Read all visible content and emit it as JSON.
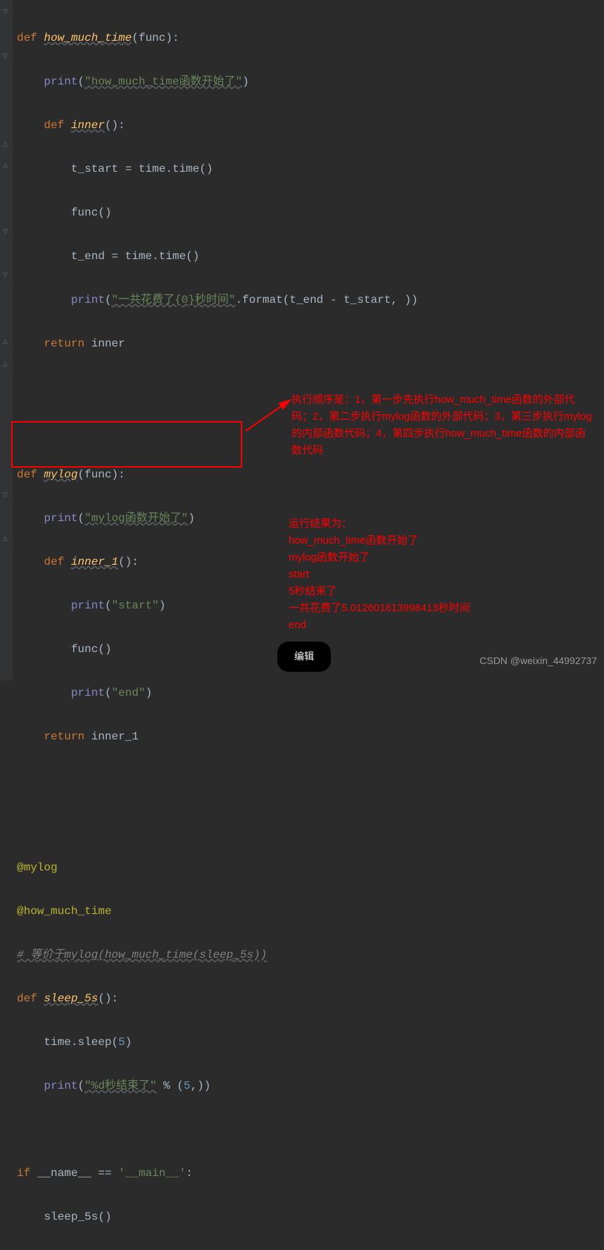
{
  "code": {
    "l1": {
      "def": "def ",
      "fn": "how_much_time",
      "args": "(func):"
    },
    "l2": {
      "pr": "print",
      "paren": "(",
      "str": "\"how_much_time函数开始了\"",
      "close": ")"
    },
    "l3": {
      "def": "def ",
      "fn": "inner",
      "args": "():"
    },
    "l4": "        t_start = time.time()",
    "l5": "        func()",
    "l6": "        t_end = time.time()",
    "l7": {
      "pr": "print",
      "paren": "(",
      "str": "\"一共花费了{0}秒时间\"",
      "fmt": ".format(t_end - t_start",
      "comma": ", ",
      "close": "))"
    },
    "l8": {
      "ret": "return ",
      "v": "inner"
    },
    "l10": {
      "def": "def ",
      "fn": "mylog",
      "args": "(func):"
    },
    "l11": {
      "pr": "print",
      "paren": "(",
      "str": "\"mylog函数开始了\"",
      "close": ")"
    },
    "l12": {
      "def": "def ",
      "fn": "inner_1",
      "args": "():"
    },
    "l13": {
      "pr": "print",
      "paren": "(",
      "str": "\"start\"",
      "close": ")"
    },
    "l14": "        func()",
    "l15": {
      "pr": "print",
      "paren": "(",
      "str": "\"end\"",
      "close": ")"
    },
    "l16": {
      "ret": "return ",
      "v": "inner_1"
    },
    "dec1": "@mylog",
    "dec2": "@how_much_time",
    "comment": "# 等价于mylog(how_much_time(sleep_5s))",
    "l20": {
      "def": "def ",
      "fn": "sleep_5s",
      "args": "():"
    },
    "l21": {
      "a": "    time.sleep(",
      "n": "5",
      "b": ")"
    },
    "l22": {
      "pr": "print",
      "paren": "(",
      "str": "\"%d秒结束了\"",
      "mod": " % (",
      "n": "5",
      "comma": ",",
      "close": "))"
    },
    "l24": {
      "if": "if ",
      "name": "__name__",
      "eq": " == ",
      "str": "'__main__'",
      "colon": ":"
    },
    "l25": "    sleep_5s()"
  },
  "annotation1": "执行顺序是：1，第一步先执行how_much_time函数的外部代码；2，第二步执行mylog函数的外部代码；3，第三步执行mylog的内部函数代码；4，第四步执行how_much_time函数的内部函数代码",
  "results": {
    "title": "运行结果为：",
    "r1": "how_much_time函数开始了",
    "r2": "mylog函数开始了",
    "r3": "start",
    "r4": "5秒结束了",
    "r5": "一共花费了5.012601613998413秒时间",
    "r6": "end"
  },
  "edit_button": "编辑",
  "watermark": "CSDN @weixin_44992737"
}
